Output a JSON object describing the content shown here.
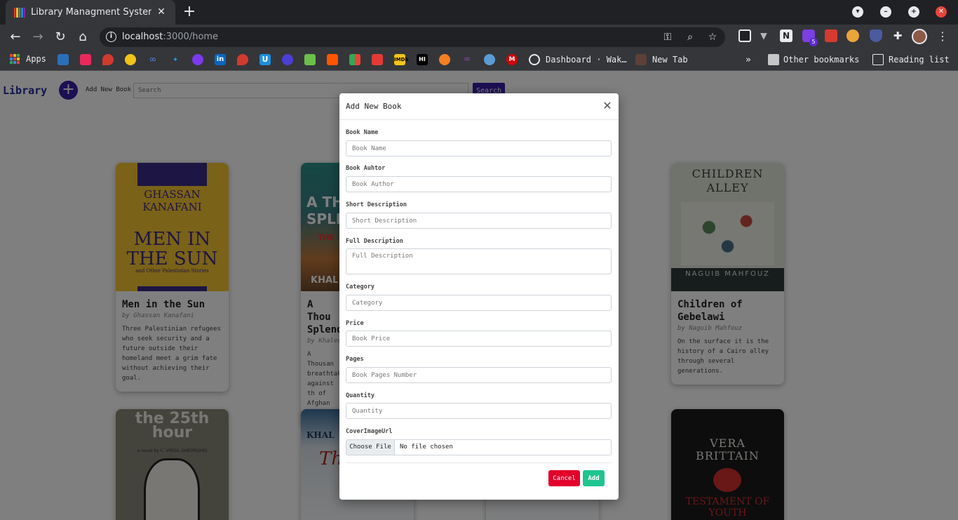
{
  "browser": {
    "tab_title": "Library Managment System",
    "url_host": "localhost",
    "url_rest": ":3000/home",
    "bookmarks_apps": "Apps",
    "bookmark_dashboard": "Dashboard · Wak…",
    "bookmark_newtab": "New Tab",
    "other_bookmarks": "Other bookmarks",
    "reading_list": "Reading list",
    "extension_badge": "5"
  },
  "nav": {
    "brand": "Library",
    "add_new_book": "Add New Book",
    "search_placeholder": "Search",
    "search_button": "Search"
  },
  "books": [
    {
      "title": "Men in the Sun",
      "author": "by Ghassan Kanafani",
      "description": "Three Palestinian refugees who seek security and a future outside their homeland meet a grim fate without achieving their goal.",
      "cover_text_1": "GHASSAN KANAFANI",
      "cover_text_2": "MEN IN THE SUN",
      "cover_text_3": "and Other Palestinian Stories"
    },
    {
      "title": "A Thou Splend",
      "author": "by Khaled",
      "description": "A Thousan breathtak against th of Afghan years",
      "cover_text_1": "A TH SPLE",
      "cover_text_2": "THE",
      "cover_text_3": "KHAL"
    },
    {
      "title": "Children of Gebelawi",
      "author": "by Naguib Mahfouz",
      "description": "On the surface it is the history of a Cairo alley through several generations.",
      "cover_text_1": "CHILDREN ALLEY",
      "cover_text_2": "NAGUIB MAHFOUZ"
    },
    {
      "cover_text_1": "the 25th hour",
      "cover_text_2": "a novel by C. VIRGIL GHEORGHIU"
    },
    {
      "cover_text_1": "KHAL",
      "cover_text_2": "The R"
    },
    {
      "cover_text_1": "VERA BRITTAIN",
      "cover_text_2": "TESTAMENT OF YOUTH"
    }
  ],
  "modal": {
    "title": "Add New Book",
    "fields": [
      {
        "label": "Book Name",
        "placeholder": "Book Name"
      },
      {
        "label": "Book Auhtor",
        "placeholder": "Book Author"
      },
      {
        "label": "Short Description",
        "placeholder": "Short Description"
      },
      {
        "label": "Full Description",
        "placeholder": "Full Description"
      },
      {
        "label": "Category",
        "placeholder": "Category"
      },
      {
        "label": "Price",
        "placeholder": "Book Price"
      },
      {
        "label": "Pages",
        "placeholder": "Book Pages Number"
      },
      {
        "label": "Quantity",
        "placeholder": "Quantity"
      }
    ],
    "cover_label": "CoverImageUrl",
    "choose_file": "Choose File",
    "no_file": "No file chosen",
    "cancel": "Cancel",
    "add": "Add"
  },
  "colors": {
    "brand": "#1f2a9a",
    "primary": "#3a1fa6",
    "cancel": "#e3002b",
    "add": "#1fc58e",
    "chrome_dark": "#202124",
    "chrome_toolbar": "#35363a"
  }
}
